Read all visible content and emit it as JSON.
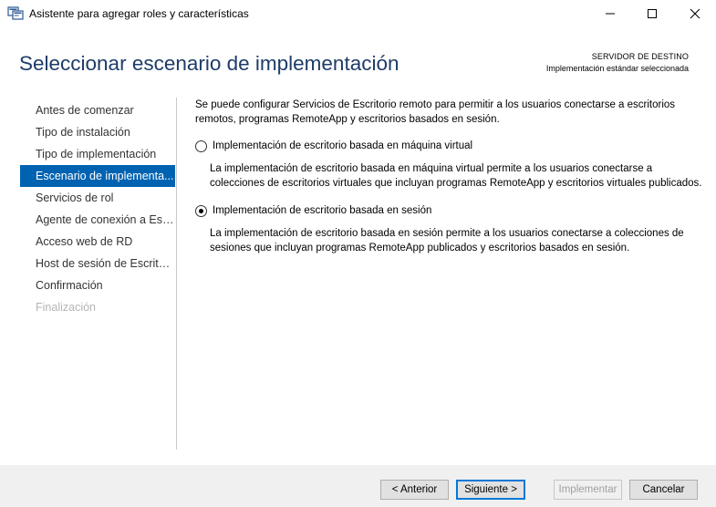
{
  "window": {
    "title": "Asistente para agregar roles y características",
    "minimize_icon": "minimize-icon",
    "maximize_icon": "maximize-icon",
    "close_icon": "close-icon"
  },
  "header": {
    "title": "Seleccionar escenario de implementación",
    "destination_label": "SERVIDOR DE DESTINO",
    "destination_value": "Implementación estándar seleccionada"
  },
  "sidebar": {
    "items": [
      {
        "label": "Antes de comenzar",
        "state": "normal"
      },
      {
        "label": "Tipo de instalación",
        "state": "normal"
      },
      {
        "label": "Tipo de implementación",
        "state": "normal"
      },
      {
        "label": "Escenario de implementa...",
        "state": "active"
      },
      {
        "label": "Servicios de rol",
        "state": "normal"
      },
      {
        "label": "Agente de conexión a Esc...",
        "state": "normal"
      },
      {
        "label": "Acceso web de RD",
        "state": "normal"
      },
      {
        "label": "Host de sesión de Escritor...",
        "state": "normal"
      },
      {
        "label": "Confirmación",
        "state": "normal"
      },
      {
        "label": "Finalización",
        "state": "disabled"
      }
    ]
  },
  "main": {
    "intro": "Se puede configurar Servicios de Escritorio remoto para permitir a los usuarios conectarse a escritorios remotos, programas RemoteApp y escritorios basados en sesión.",
    "options": [
      {
        "label": "Implementación de escritorio basada en máquina virtual",
        "description": "La implementación de escritorio basada en máquina virtual permite a los usuarios conectarse a colecciones de escritorios virtuales que incluyan programas RemoteApp y escritorios virtuales publicados.",
        "selected": false
      },
      {
        "label": "Implementación de escritorio basada en sesión",
        "description": "La implementación de escritorio basada en sesión permite a los usuarios conectarse a colecciones de sesiones que incluyan programas RemoteApp publicados y escritorios basados en sesión.",
        "selected": true
      }
    ]
  },
  "footer": {
    "back_label": "< Anterior",
    "next_label": "Siguiente >",
    "install_label": "Implementar",
    "cancel_label": "Cancelar"
  },
  "colors": {
    "title_blue": "#1e3c68",
    "selection_blue": "#0063b1",
    "default_button_border": "#0078d7"
  }
}
